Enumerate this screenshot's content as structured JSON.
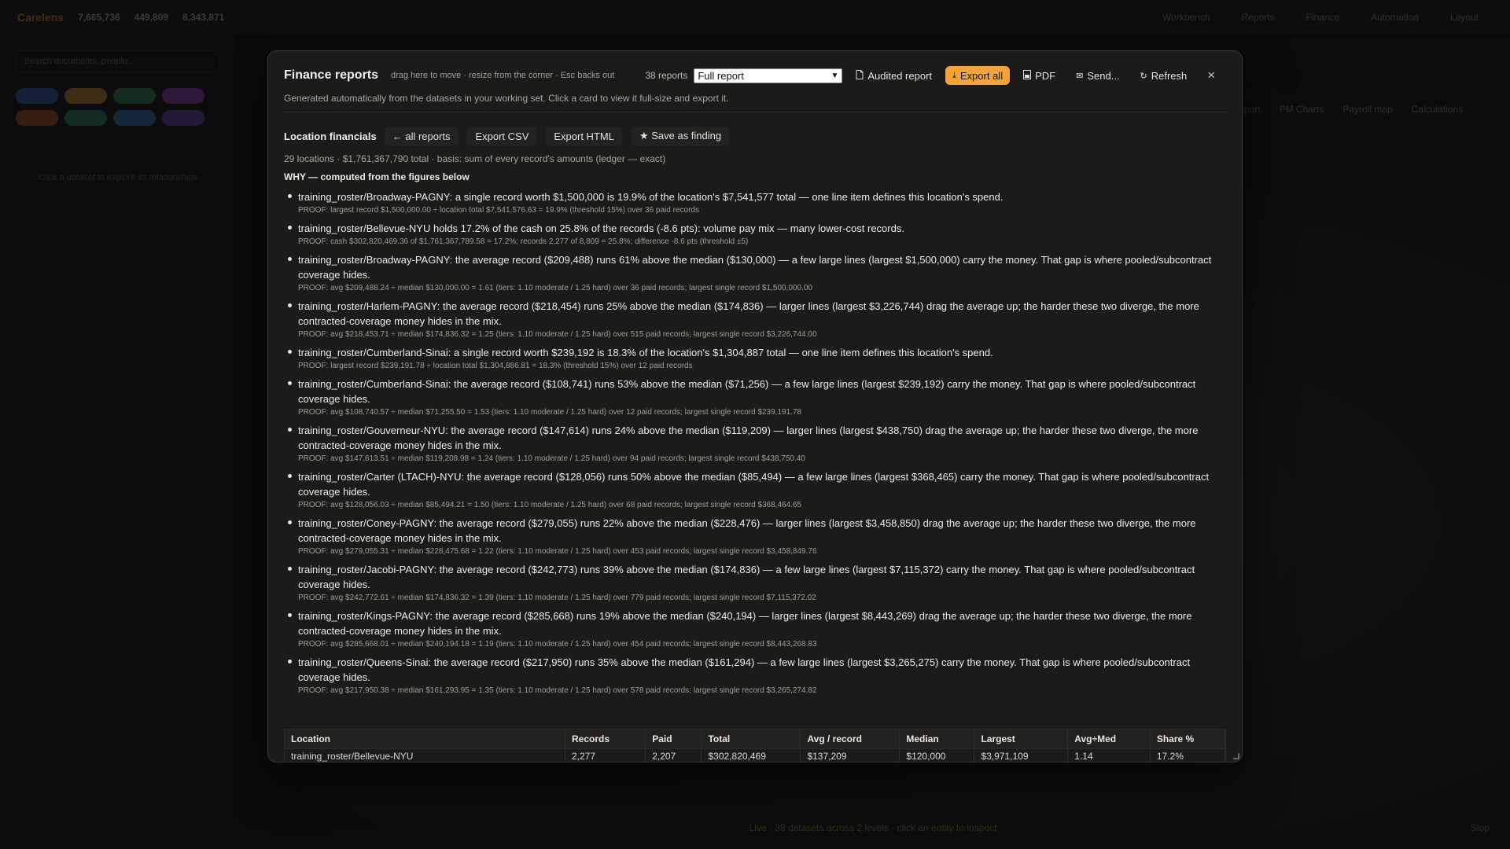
{
  "background": {
    "logo": "Carelens",
    "stats": [
      "7,665,736",
      "449,809",
      "8,343,871"
    ],
    "search_placeholder": "Search documents, people…",
    "hint": "Click a dataset to explore its relationships",
    "right_nav": [
      "Workbench",
      "Reports",
      "Finance",
      "Automation",
      "Layout"
    ],
    "right_chips": [
      "Export",
      "PM Charts",
      "Payroll map",
      "Calculations"
    ],
    "status_line": "Live · 38 datasets across 2 levels · click an entity to inspect",
    "status_stop": "Stop",
    "pill_colors": [
      "#3b6fd6",
      "#e8a53a",
      "#2aa864",
      "#a64fd6",
      "#d0642e",
      "#23a07a",
      "#3a8ad6",
      "#7a52c8"
    ]
  },
  "modal": {
    "title": "Finance reports",
    "drag_hint": "drag here to move · resize from the corner · Esc backs out",
    "report_count": "38 reports",
    "select_value": "Full report",
    "buttons": {
      "audited": "Audited report",
      "export_all": "Export all",
      "pdf": "PDF",
      "send": "Send...",
      "refresh": "Refresh"
    },
    "icons": {
      "audited": "document-icon",
      "export_all": "download-icon",
      "pdf": "pdf-icon",
      "send": "mail-icon",
      "refresh": "refresh-icon",
      "close": "close-icon"
    },
    "subtitle": "Generated automatically from the datasets in your working set. Click a card to view it full-size and export it."
  },
  "section": {
    "title": "Location financials",
    "back": "← all reports",
    "export_csv": "Export CSV",
    "export_html": "Export HTML",
    "save_finding": "★ Save as finding",
    "summary": "29 locations · $1,761,367,790 total · basis: sum of every record's amounts (ledger — exact)",
    "why_heading": "WHY — computed from the figures below"
  },
  "findings": [
    {
      "text": "training_roster/Broadway-PAGNY: a single record worth $1,500,000 is 19.9% of the location's $7,541,577 total — one line item defines this location's spend.",
      "proof": "PROOF: largest record $1,500,000.00 ÷ location total $7,541,576.63 = 19.9% (threshold 15%) over 36 paid records"
    },
    {
      "text": "training_roster/Bellevue-NYU holds 17.2% of the cash on 25.8% of the records (-8.6 pts): volume pay mix — many lower-cost records.",
      "proof": "PROOF: cash $302,820,469.36 of $1,761,367,789.58 = 17.2%; records 2,277 of 8,809 = 25.8%; difference -8.6 pts (threshold ±5)"
    },
    {
      "text": "training_roster/Broadway-PAGNY: the average record ($209,488) runs 61% above the median ($130,000) — a few large lines (largest $1,500,000) carry the money. That gap is where pooled/subcontract coverage hides.",
      "proof": "PROOF: avg $209,488.24 ÷ median $130,000.00 = 1.61 (tiers: 1.10 moderate / 1.25 hard) over 36 paid records; largest single record $1,500,000.00"
    },
    {
      "text": "training_roster/Harlem-PAGNY: the average record ($218,454) runs 25% above the median ($174,836) — larger lines (largest $3,226,744) drag the average up; the harder these two diverge, the more contracted-coverage money hides in the mix.",
      "proof": "PROOF: avg $218,453.71 ÷ median $174,836.32 = 1.25 (tiers: 1.10 moderate / 1.25 hard) over 515 paid records; largest single record $3,226,744.00"
    },
    {
      "text": "training_roster/Cumberland-Sinai: a single record worth $239,192 is 18.3% of the location's $1,304,887 total — one line item defines this location's spend.",
      "proof": "PROOF: largest record $239,191.78 ÷ location total $1,304,886.81 = 18.3% (threshold 15%) over 12 paid records"
    },
    {
      "text": "training_roster/Cumberland-Sinai: the average record ($108,741) runs 53% above the median ($71,256) — a few large lines (largest $239,192) carry the money. That gap is where pooled/subcontract coverage hides.",
      "proof": "PROOF: avg $108,740.57 ÷ median $71,255.50 = 1.53 (tiers: 1.10 moderate / 1.25 hard) over 12 paid records; largest single record $239,191.78"
    },
    {
      "text": "training_roster/Gouverneur-NYU: the average record ($147,614) runs 24% above the median ($119,209) — larger lines (largest $438,750) drag the average up; the harder these two diverge, the more contracted-coverage money hides in the mix.",
      "proof": "PROOF: avg $147,613.51 ÷ median $119,208.98 = 1.24 (tiers: 1.10 moderate / 1.25 hard) over 94 paid records; largest single record $438,750.40"
    },
    {
      "text": "training_roster/Carter (LTACH)-NYU: the average record ($128,056) runs 50% above the median ($85,494) — a few large lines (largest $368,465) carry the money. That gap is where pooled/subcontract coverage hides.",
      "proof": "PROOF: avg $128,056.03 ÷ median $85,494.21 = 1.50 (tiers: 1.10 moderate / 1.25 hard) over 68 paid records; largest single record $368,464.65"
    },
    {
      "text": "training_roster/Coney-PAGNY: the average record ($279,055) runs 22% above the median ($228,476) — larger lines (largest $3,458,850) drag the average up; the harder these two diverge, the more contracted-coverage money hides in the mix.",
      "proof": "PROOF: avg $279,055.31 ÷ median $228,475.68 = 1.22 (tiers: 1.10 moderate / 1.25 hard) over 453 paid records; largest single record $3,458,849.76"
    },
    {
      "text": "training_roster/Jacobi-PAGNY: the average record ($242,773) runs 39% above the median ($174,836) — a few large lines (largest $7,115,372) carry the money. That gap is where pooled/subcontract coverage hides.",
      "proof": "PROOF: avg $242,772.61 ÷ median $174,836.32 = 1.39 (tiers: 1.10 moderate / 1.25 hard) over 779 paid records; largest single record $7,115,372.02"
    },
    {
      "text": "training_roster/Kings-PAGNY: the average record ($285,668) runs 19% above the median ($240,194) — larger lines (largest $8,443,269) drag the average up; the harder these two diverge, the more contracted-coverage money hides in the mix.",
      "proof": "PROOF: avg $285,668.01 ÷ median $240,194.18 = 1.19 (tiers: 1.10 moderate / 1.25 hard) over 454 paid records; largest single record $8,443,268.83"
    },
    {
      "text": "training_roster/Queens-Sinai: the average record ($217,950) runs 35% above the median ($161,294) — a few large lines (largest $3,265,275) carry the money. That gap is where pooled/subcontract coverage hides.",
      "proof": "PROOF: avg $217,950.38 ÷ median $161,293.95 = 1.35 (tiers: 1.10 moderate / 1.25 hard) over 578 paid records; largest single record $3,265,274.82"
    }
  ],
  "table": {
    "headers": [
      "Location",
      "Records",
      "Paid",
      "Total",
      "Avg / record",
      "Median",
      "Largest",
      "Avg÷Med",
      "Share %"
    ],
    "rows": [
      [
        "training_roster/Bellevue-NYU",
        "2,277",
        "2,207",
        "$302,820,469",
        "$137,209",
        "$120,000",
        "$3,971,109",
        "1.14",
        "17.2%"
      ]
    ]
  }
}
